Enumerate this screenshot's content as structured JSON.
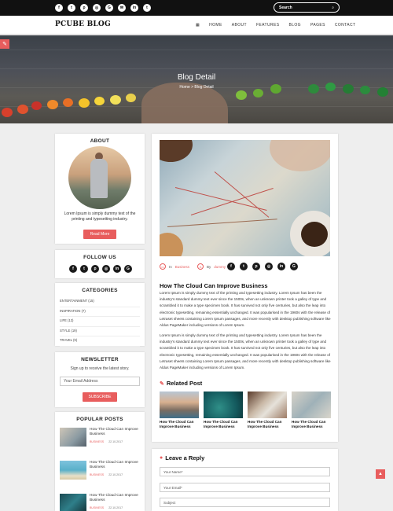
{
  "topbar": {
    "social_icons": [
      "facebook-icon",
      "twitter-icon",
      "pinterest-icon",
      "instagram-icon",
      "googleplus-icon",
      "email-icon",
      "linkedin-icon",
      "tumblr-icon"
    ],
    "social_glyphs": [
      "f",
      "t",
      "p",
      "◎",
      "G",
      "✉",
      "in",
      "t"
    ],
    "search_placeholder": "Search",
    "search_glyph": "⌕"
  },
  "nav": {
    "logo": "PCUBE BLOG",
    "grid_glyph": "▦",
    "links": [
      "HOME",
      "ABOUT",
      "FEATURES",
      "BLOG",
      "PAGES",
      "CONTACT"
    ]
  },
  "hero": {
    "title": "Blog Detail",
    "breadcrumb": "Home > Blog Detail"
  },
  "sidebar": {
    "about": {
      "heading": "ABOUT",
      "text": "Lorem Ipsum is simply dummy text of the printing and typesetting industry.",
      "button": "Read More"
    },
    "follow": {
      "heading": "FOLLOW US",
      "glyphs": [
        "f",
        "t",
        "p",
        "◎",
        "in",
        "G"
      ]
    },
    "categories": {
      "heading": "CATEGORIES",
      "items": [
        "ENTERTAINMENT (15)",
        "INSPIRATION (7)",
        "LIFE (12)",
        "STYLE (19)",
        "TRAVEL (9)"
      ]
    },
    "newsletter": {
      "heading": "NEWSLETTER",
      "text": "Sign up to receive the latest story.",
      "email_placeholder": "Your Email Address",
      "button": "SUBSCRIBE"
    },
    "popular": {
      "heading": "POPULAR POSTS",
      "posts": [
        {
          "title": "How The Cloud Can Improve Business",
          "category": "BUSINESS",
          "date": "22.10.2017"
        },
        {
          "title": "How The Cloud Can Improve Business",
          "category": "BUSINESS",
          "date": "22.10.2017"
        },
        {
          "title": "How The Cloud Can Improve Business",
          "category": "BUSINESS",
          "date": "22.10.2017"
        }
      ]
    }
  },
  "post": {
    "meta_in": "In",
    "meta_category": "Business",
    "meta_by": "By",
    "meta_author": "dummy",
    "share_glyphs": [
      "f",
      "t",
      "p",
      "◎",
      "in",
      "G"
    ],
    "title": "How The Cloud Can Improve Business",
    "paragraph1": "Lorem Ipsum is simply dummy text of the printing and typesetting industry. Lorem Ipsum has been the industry's standard dummy text ever since the 1500s, when an unknown printer took a galley of type and scrambled it to make a type specimen book. It has survived not only five centuries, but also the leap into electronic typesetting, remaining essentially unchanged. It was popularised in the 1960s with the release of Letraset sheets containing Lorem Ipsum passages, and more recently with desktop publishing software like Aldus PageMaker including versions of Lorem Ipsum.",
    "paragraph2": "Lorem Ipsum is simply dummy text of the printing and typesetting industry. Lorem Ipsum has been the industry's standard dummy text ever since the 1500s, when an unknown printer took a galley of type and scrambled it to make a type specimen book. It has survived not only five centuries, but also the leap into electronic typesetting, remaining essentially unchanged. It was popularised in the 1960s with the release of Letraset sheets containing Lorem Ipsum passages, and more recently with desktop publishing software like Aldus PageMaker including versions of Lorem Ipsum.",
    "related_heading": "Related Post",
    "related": [
      {
        "title": "How The Cloud Can Improve Business"
      },
      {
        "title": "How The Cloud Can Improve Business"
      },
      {
        "title": "How The Cloud Can Improve Business"
      },
      {
        "title": "How The Cloud Can Improve Business"
      }
    ]
  },
  "reply": {
    "heading": "Leave a Reply",
    "name_placeholder": "Your Name*",
    "email_placeholder": "Your Email*",
    "subject_placeholder": "Subject"
  },
  "colors": {
    "accent": "#e85d5d",
    "dark": "#111111"
  }
}
